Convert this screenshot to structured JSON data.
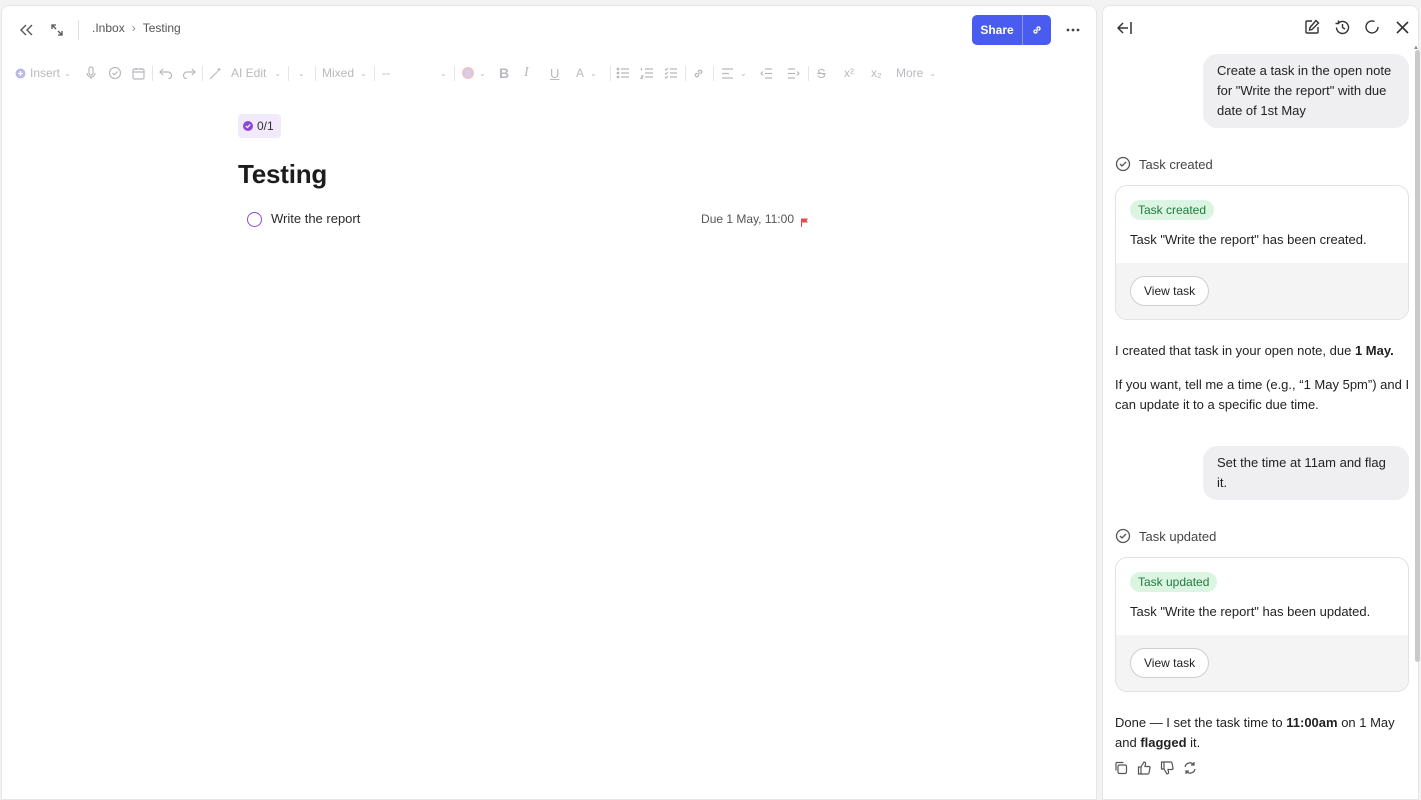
{
  "editor": {
    "breadcrumb": {
      "parent": ".Inbox",
      "separator": "›",
      "current": "Testing"
    },
    "share_label": "Share",
    "toolbar": {
      "insert_label": "Insert",
      "ai_edit_label": "AI Edit",
      "style_label": "Mixed",
      "font_label": "--",
      "more_label": "More"
    },
    "task_count": "0/1",
    "title": "Testing",
    "task": {
      "text": "Write the report",
      "due": "Due 1 May, 11:00"
    }
  },
  "chat": {
    "user_msg_1": "Create a task in the open note for \"Write the report\" with due date of 1st May",
    "status_1": "Task created",
    "card_1": {
      "badge": "Task created",
      "message": "Task \"Write the report\" has been created.",
      "button": "View task"
    },
    "reply_1a_pre": "I created that task in your open note, due ",
    "reply_1a_bold": "1 May.",
    "reply_1b": "If you want, tell me a time (e.g., “1 May 5pm”) and I can update it to a specific due time.",
    "user_msg_2": "Set the time at 11am and flag it.",
    "status_2": "Task updated",
    "card_2": {
      "badge": "Task updated",
      "message": "Task \"Write the report\" has been updated.",
      "button": "View task"
    },
    "reply_2_p1": "Done — I set the task time to ",
    "reply_2_b1": "11:00am",
    "reply_2_p2": " on 1 May and ",
    "reply_2_b2": "flagged",
    "reply_2_p3": " it."
  },
  "colors": {
    "accent": "#4a5cf0",
    "task_purple": "#8b4ad6",
    "flag_red": "#e5484d",
    "success_bg": "#dcf5e3",
    "success_text": "#1e7b3c"
  }
}
